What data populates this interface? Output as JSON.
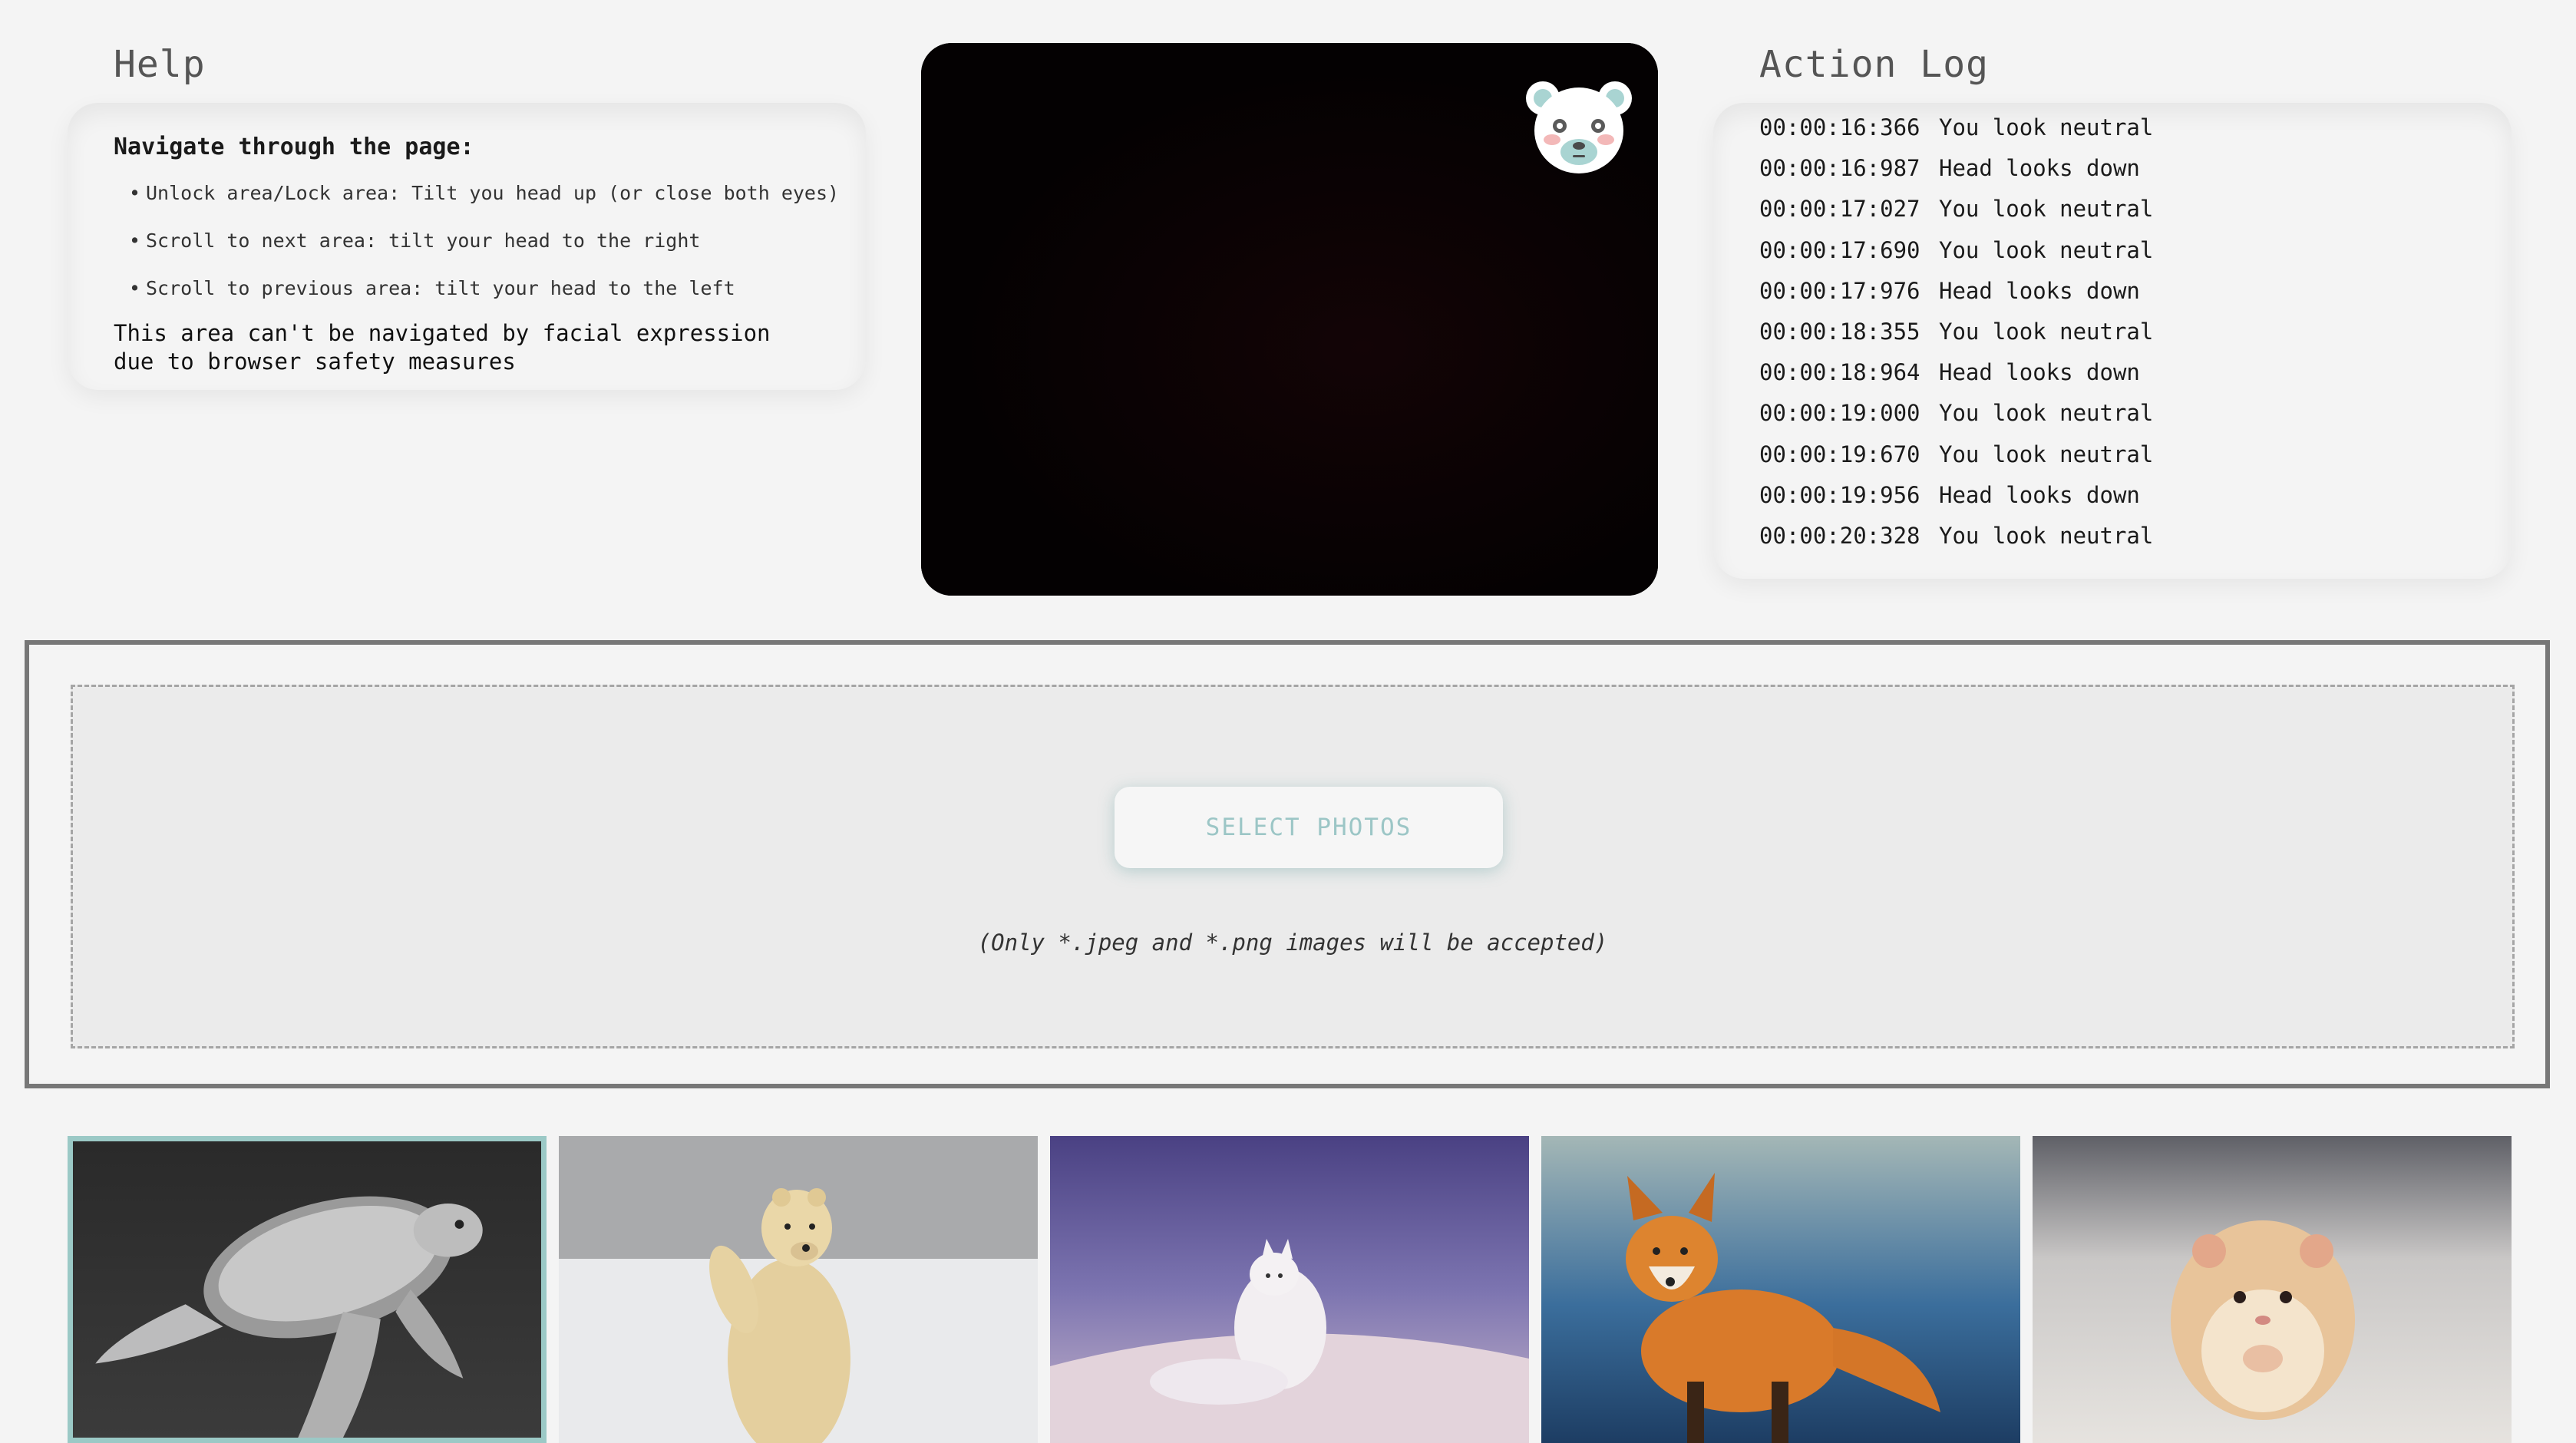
{
  "help": {
    "heading": "Help",
    "title": "Navigate through the page:",
    "items": [
      "Unlock area/Lock area: Tilt you head up (or close both eyes)",
      "Scroll to next area: tilt your head to the right",
      "Scroll to previous area: tilt your head to the left"
    ],
    "note": "This area can't be navigated by facial expression due to browser safety measures"
  },
  "action_log": {
    "heading": "Action Log",
    "entries": [
      {
        "time": "00:00:16:366",
        "text": "You look neutral"
      },
      {
        "time": "00:00:16:987",
        "text": "Head looks down"
      },
      {
        "time": "00:00:17:027",
        "text": "You look neutral"
      },
      {
        "time": "00:00:17:690",
        "text": "You look neutral"
      },
      {
        "time": "00:00:17:976",
        "text": "Head looks down"
      },
      {
        "time": "00:00:18:355",
        "text": "You look neutral"
      },
      {
        "time": "00:00:18:964",
        "text": "Head looks down"
      },
      {
        "time": "00:00:19:000",
        "text": "You look neutral"
      },
      {
        "time": "00:00:19:670",
        "text": "You look neutral"
      },
      {
        "time": "00:00:19:956",
        "text": "Head looks down"
      },
      {
        "time": "00:00:20:328",
        "text": "You look neutral"
      }
    ]
  },
  "webcam": {
    "overlay_icon": "polar-bear-face-icon"
  },
  "upload": {
    "button_label": "SELECT PHOTOS",
    "note": "(Only *.jpeg and *.png images will be accepted)"
  },
  "gallery": {
    "photos": [
      {
        "subject": "sea turtle",
        "selected": true
      },
      {
        "subject": "polar bear",
        "selected": false
      },
      {
        "subject": "arctic fox",
        "selected": false
      },
      {
        "subject": "red fox",
        "selected": false
      },
      {
        "subject": "hamster",
        "selected": false
      }
    ]
  },
  "colors": {
    "accent": "#9bc9c6",
    "background": "#f4f4f4",
    "drop_zone": "#ebebeb"
  }
}
